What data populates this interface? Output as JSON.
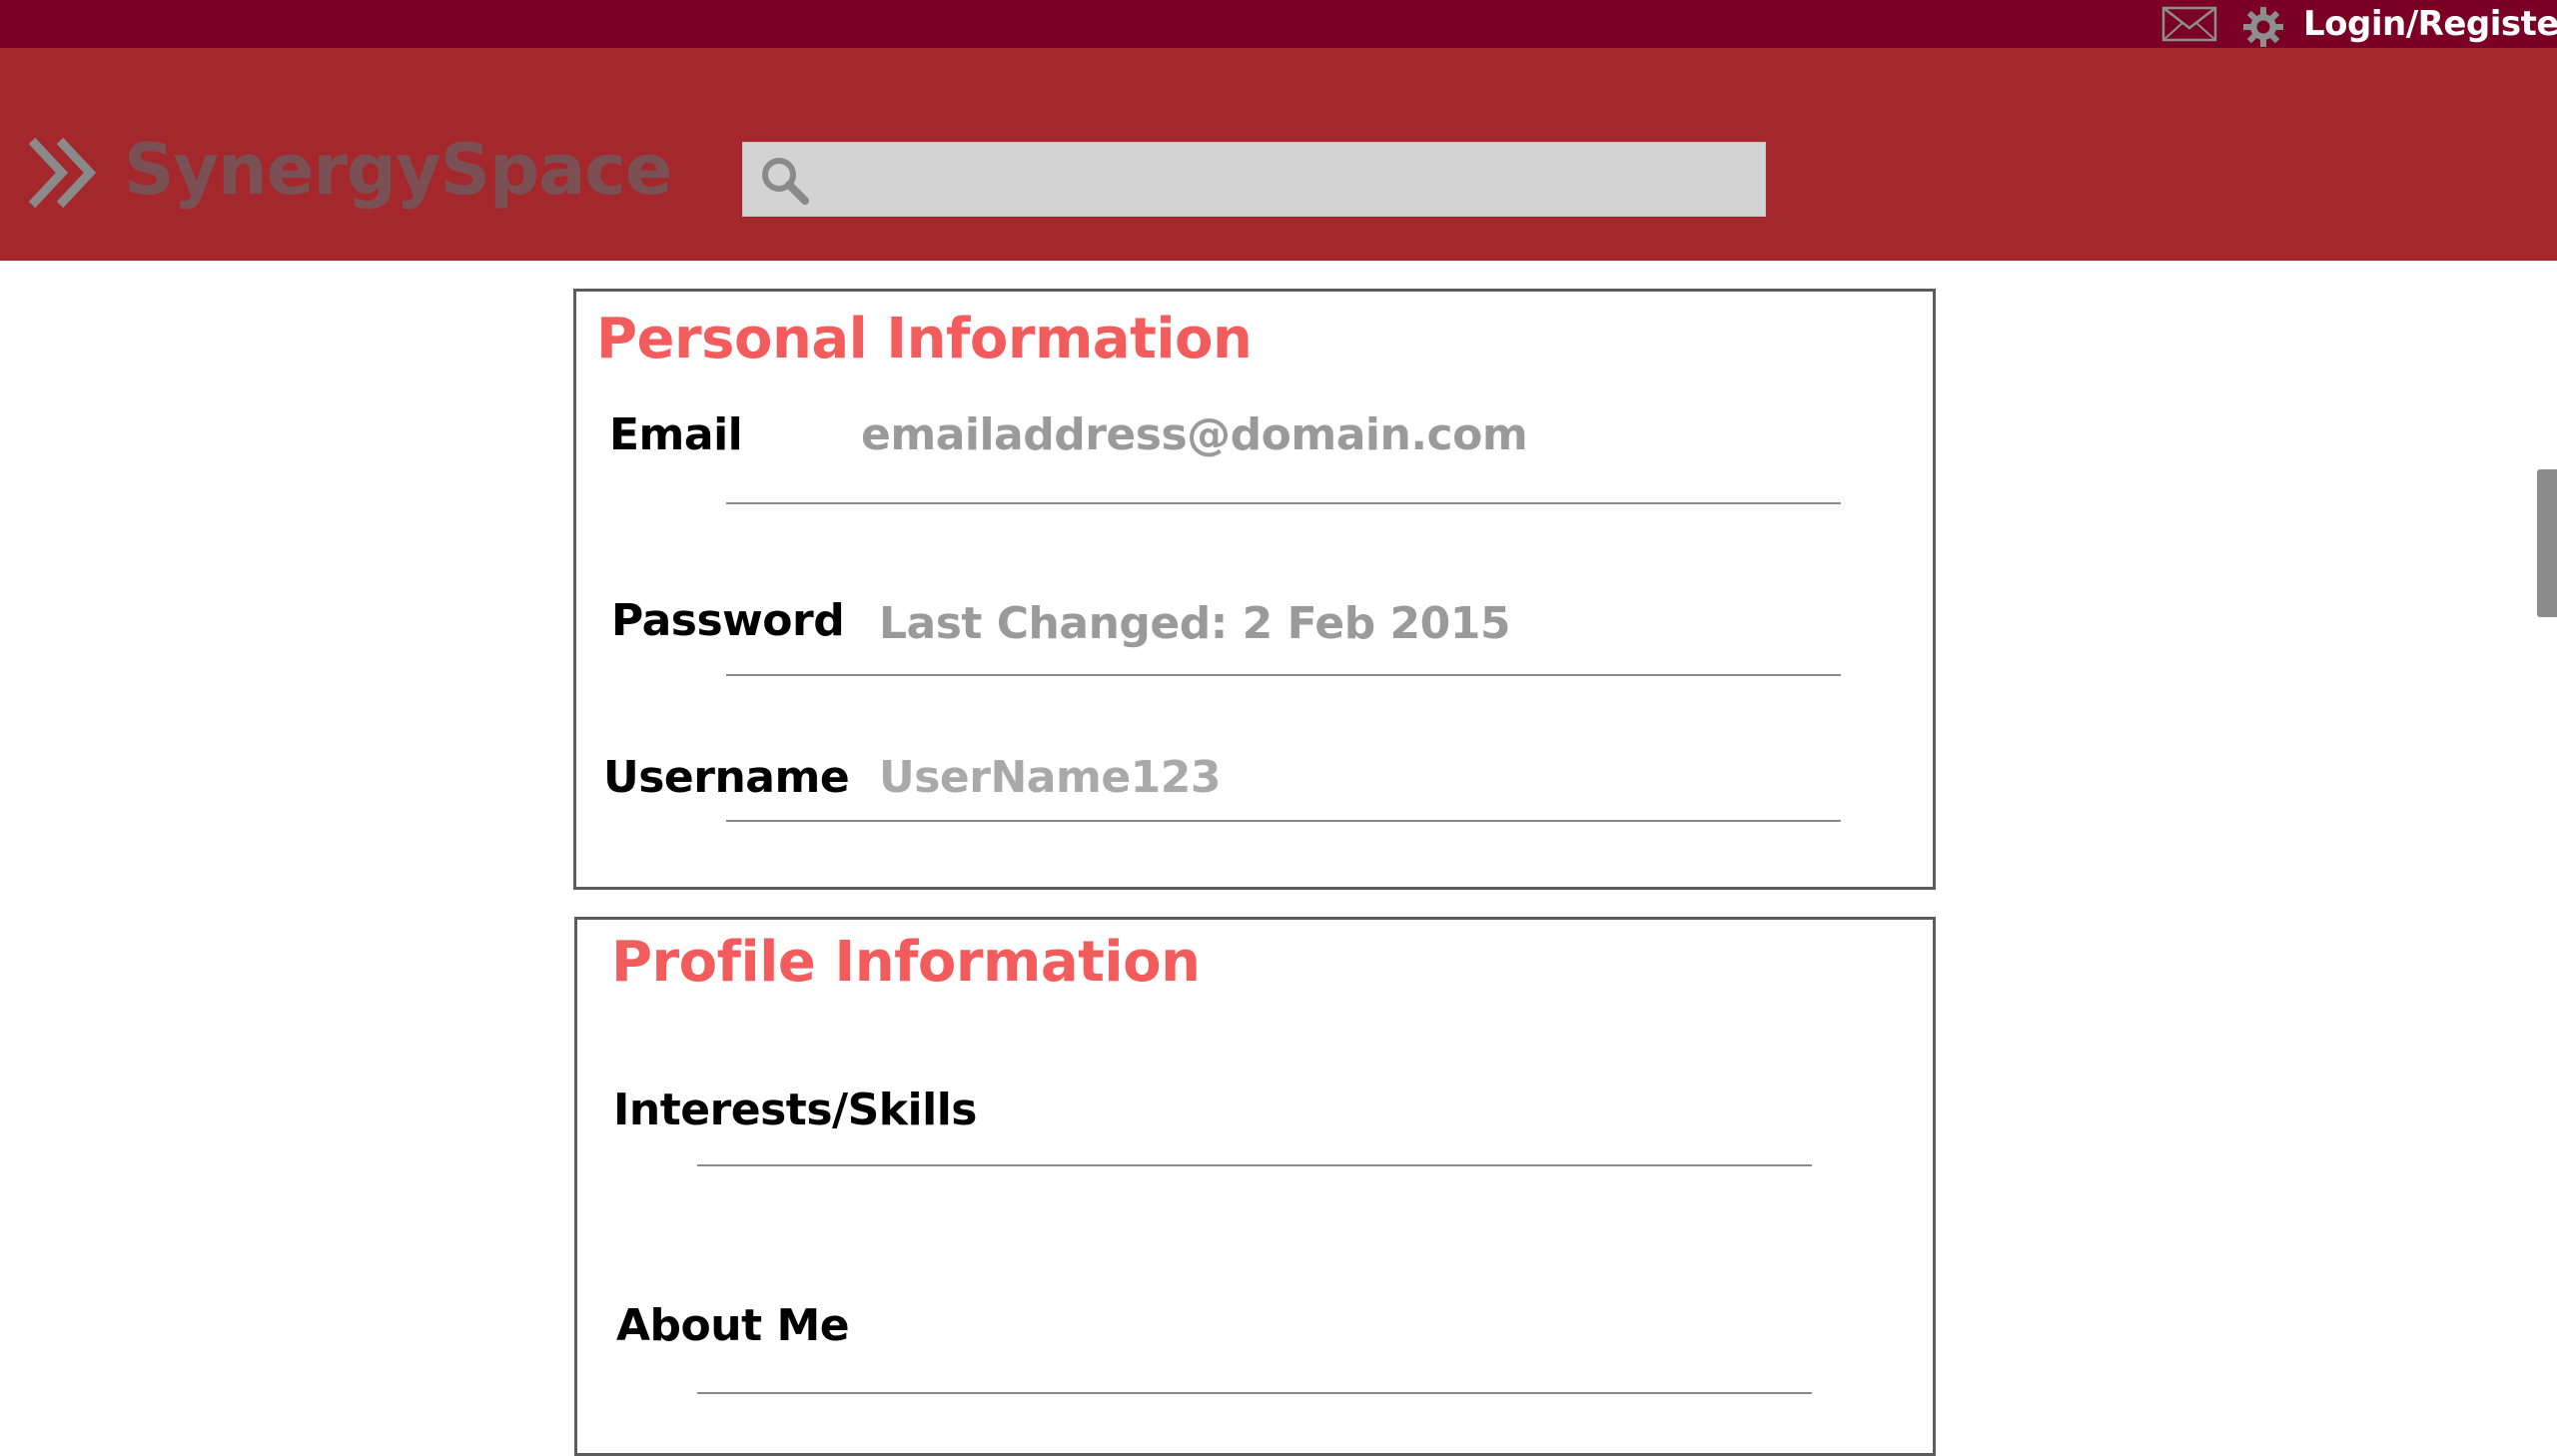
{
  "topbar": {
    "login_label": "Login/Register",
    "icons": [
      "mail-icon",
      "gear-icon"
    ]
  },
  "header": {
    "brand": "SynergySpace",
    "logo_icon": "double-chevron-right-icon",
    "search_placeholder": "",
    "search_value": ""
  },
  "personal": {
    "title": "Personal Information",
    "email_label": "Email",
    "email_value": "emailaddress@domain.com",
    "password_label": "Password",
    "password_value": "Last Changed: 2 Feb 2015",
    "username_label": "Username",
    "username_value": "UserName123"
  },
  "profile": {
    "title": "Profile Information",
    "interests_label": "Interests/Skills",
    "interests_value": "",
    "about_label": "About Me",
    "about_value": ""
  },
  "colors": {
    "topbar": "#7a0026",
    "header": "#a3272b",
    "brand_text": "#7b5055",
    "section_title": "#f25c5c",
    "value_text": "#9a9a9a",
    "search_bg": "#d3d3d3"
  }
}
